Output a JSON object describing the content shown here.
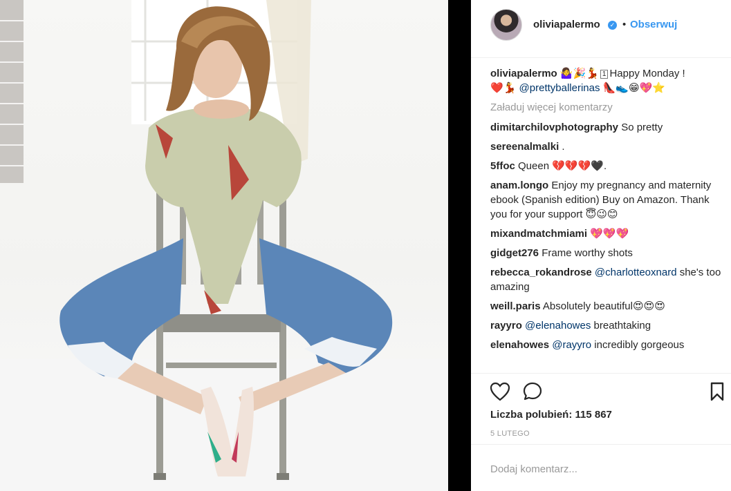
{
  "header": {
    "username": "oliviapalermo",
    "separator": "•",
    "follow_label": "Obserwuj"
  },
  "caption": {
    "username": "oliviapalermo",
    "emojis_before": "🤷‍♀️🎉💃",
    "keycap": "1",
    "text": "Happy Monday !",
    "emojis_line2": "❤️💃",
    "mention": "@prettyballerinas",
    "emojis_after": "👠👟😁💖⭐"
  },
  "load_more_label": "Załaduj więcej komentarzy",
  "comments": [
    {
      "username": "dimitarchilovphotography",
      "text": "So pretty",
      "emojis": ""
    },
    {
      "username": "sereenalmalki",
      "text": ".",
      "emojis": ""
    },
    {
      "username": "5ffoc",
      "text": "Queen",
      "emojis": "💔💔💔🖤",
      "tail": "."
    },
    {
      "username": "anam.longo",
      "text": "Enjoy my pregnancy and maternity ebook (Spanish edition) Buy on Amazon. Thank you for your support",
      "emojis": "😇😉😊"
    },
    {
      "username": "mixandmatchmiami",
      "text": "",
      "emojis": "💖💖💖"
    },
    {
      "username": "gidget276",
      "text": "Frame worthy shots",
      "emojis": ""
    },
    {
      "username": "rebecca_rokandrose",
      "mention": "@charlotteoxnard",
      "text": "she's too amazing",
      "emojis": ""
    },
    {
      "username": "weill.paris",
      "text": "Absolutely beautiful",
      "emojis": "😍😍😍"
    },
    {
      "username": "rayyro",
      "mention": "@elenahowes",
      "text": "breathtaking",
      "emojis": ""
    },
    {
      "username": "elenahowes",
      "mention": "@rayyro",
      "text": "incredibly gorgeous",
      "emojis": ""
    }
  ],
  "likes_text": "Liczba polubień: 115 867",
  "date_text": "5 LUTEGO",
  "add_comment_placeholder": "Dodaj komentarz...",
  "icons": {
    "like": "heart-outline-icon",
    "comment": "speech-bubble-icon",
    "save": "bookmark-icon",
    "verified": "verified-badge-icon"
  },
  "colors": {
    "link_blue": "#3897f0",
    "mention_blue": "#003569",
    "muted_gray": "#999999",
    "text": "#262626",
    "divider": "#000000"
  }
}
